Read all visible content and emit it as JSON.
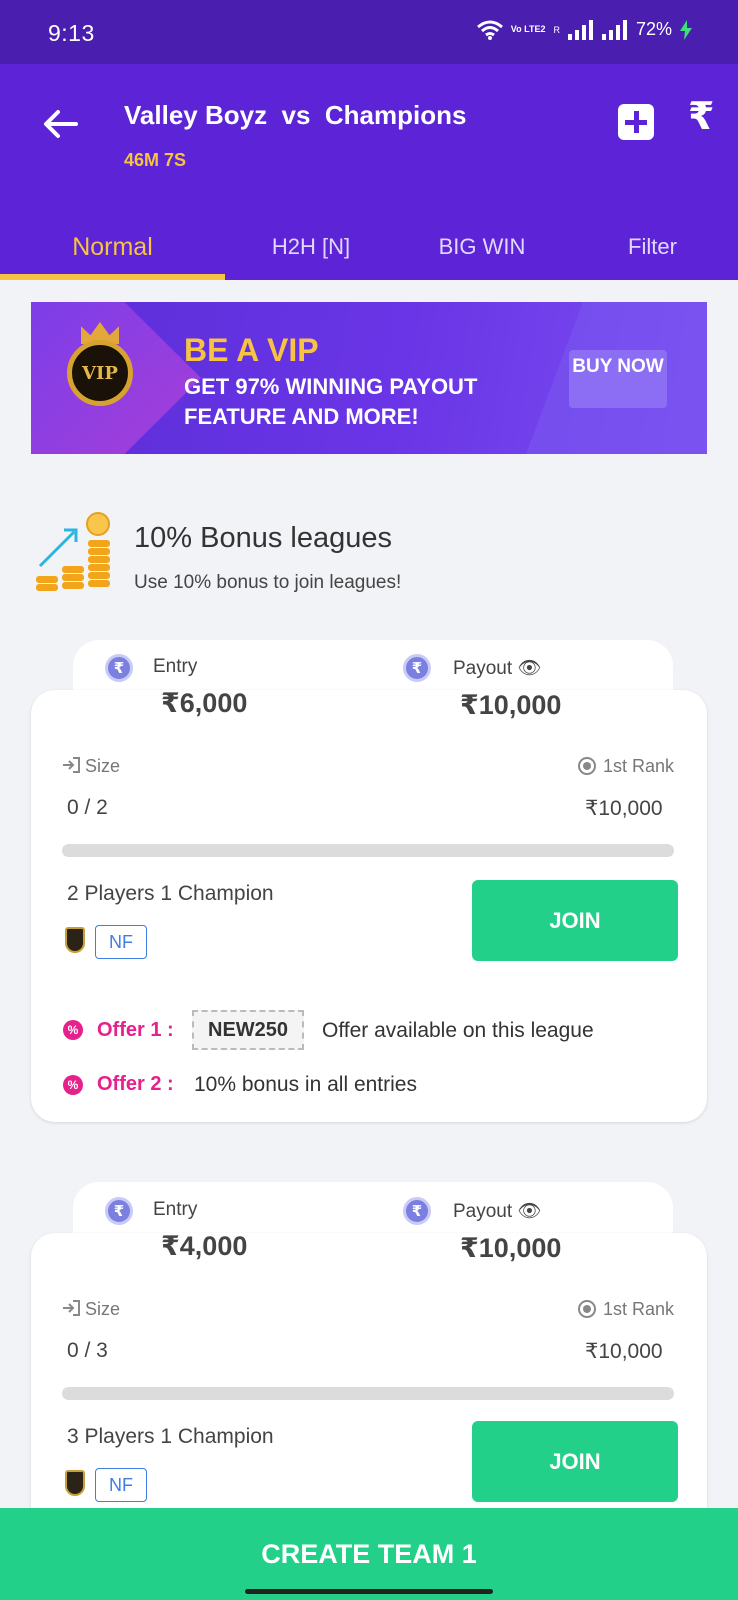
{
  "status_bar": {
    "time": "9:13",
    "battery": "72%",
    "volte": "Vo LTE2",
    "roaming": "R"
  },
  "header": {
    "title": "Valley Boyz  vs  Champions",
    "countdown": "46M 7S",
    "rupee_icon": "₹",
    "tabs": [
      {
        "label": "Normal",
        "active": true
      },
      {
        "label": "H2H [N]"
      },
      {
        "label": "BIG WIN"
      },
      {
        "label": "Filter"
      }
    ]
  },
  "banner": {
    "badge": "VIP",
    "headline": "BE A VIP",
    "subline": "GET 97% WINNING PAYOUT FEATURE AND MORE!",
    "cta": "BUY NOW"
  },
  "bonus_section": {
    "title": "10% Bonus leagues",
    "subtitle": "Use 10% bonus to join leagues!"
  },
  "contests": [
    {
      "entry_label": "Entry",
      "entry_amount": "₹6,000",
      "payout_label": "Payout 👁",
      "payout_amount": "₹10,000",
      "size_label": "Size",
      "size_value": "0 / 2",
      "rank_label": "1st Rank",
      "rank_value": "₹10,000",
      "fill_fraction": 0,
      "description": "2 Players 1 Champion",
      "tag": "NF",
      "join_label": "JOIN",
      "offers": [
        {
          "label": "Offer 1 :",
          "code": "NEW250",
          "text": "Offer available on this league"
        },
        {
          "label": "Offer 2 :",
          "text": "10% bonus in all entries"
        }
      ]
    },
    {
      "entry_label": "Entry",
      "entry_amount": "₹4,000",
      "payout_label": "Payout 👁",
      "payout_amount": "₹10,000",
      "size_label": "Size",
      "size_value": "0 / 3",
      "rank_label": "1st Rank",
      "rank_value": "₹10,000",
      "fill_fraction": 0,
      "description": "3 Players 1 Champion",
      "tag": "NF",
      "join_label": "JOIN"
    }
  ],
  "footer": {
    "cta": "CREATE TEAM 1"
  },
  "colors": {
    "header": "#5c24d6",
    "accent": "#f6c343",
    "join": "#22d08a",
    "offer": "#e6218c"
  }
}
